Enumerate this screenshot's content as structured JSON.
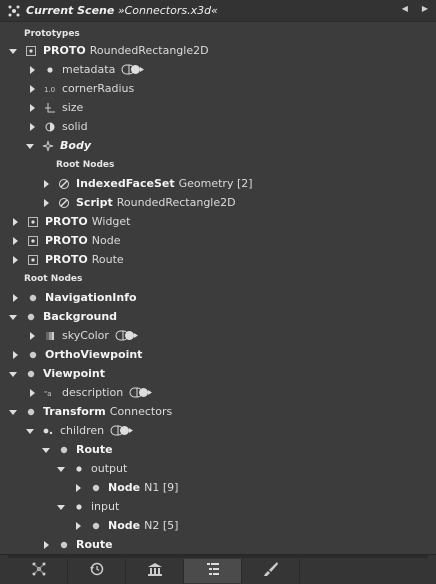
{
  "titlebar": {
    "title": "Current Scene",
    "filename": " »Connectors.x3d«",
    "nav_prev": "◀",
    "nav_next": "▶"
  },
  "tree": {
    "prototypes_heading": "Prototypes",
    "rounded_rect": {
      "keyword": "PROTO",
      "name": "RoundedRectangle2D"
    },
    "metadata": "metadata",
    "corner_radius": "cornerRadius",
    "size": "size",
    "solid": "solid",
    "body": "Body",
    "body_root_nodes": "Root Nodes",
    "indexed_face_set": {
      "type": "IndexedFaceSet",
      "name": "Geometry [2]"
    },
    "script": {
      "type": "Script",
      "name": "RoundedRectangle2D"
    },
    "widget": {
      "keyword": "PROTO",
      "name": "Widget"
    },
    "node_proto": {
      "keyword": "PROTO",
      "name": "Node"
    },
    "route_proto": {
      "keyword": "PROTO",
      "name": "Route"
    },
    "root_nodes_heading": "Root Nodes",
    "navigation_info": "NavigationInfo",
    "background": "Background",
    "sky_color": "skyColor",
    "ortho_viewpoint": "OrthoViewpoint",
    "viewpoint": "Viewpoint",
    "description": "description",
    "transform": {
      "type": "Transform",
      "name": "Connectors"
    },
    "children": "children",
    "route1": "Route",
    "output": "output",
    "node_n1": {
      "type": "Node",
      "name": "N1 [9]"
    },
    "input": "input",
    "node_n2": {
      "type": "Node",
      "name": "N2 [5]"
    },
    "route2": "Route"
  },
  "bottom_tabs": [
    {
      "icon": "outline-icon"
    },
    {
      "icon": "history-icon"
    },
    {
      "icon": "library-icon"
    },
    {
      "icon": "outline-tree-icon",
      "active": true
    },
    {
      "icon": "brush-icon"
    }
  ],
  "colors": {
    "background": "#3c3c3c",
    "titlebar": "#333333",
    "text": "#e8e8e8"
  }
}
